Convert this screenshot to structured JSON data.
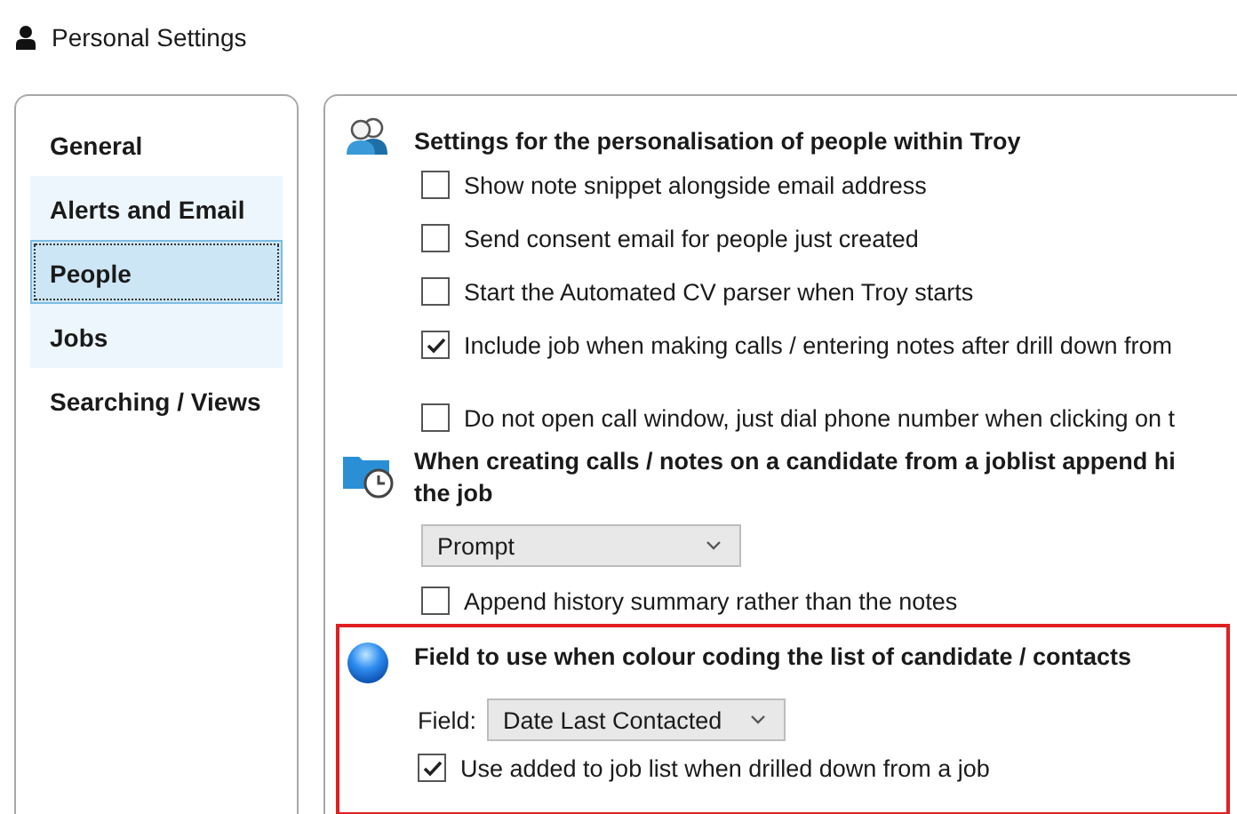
{
  "window": {
    "title": "Personal Settings"
  },
  "sidebar": {
    "items": [
      {
        "label": "General",
        "selected": false,
        "highlighted": false
      },
      {
        "label": "Alerts and Email",
        "selected": false,
        "highlighted": true
      },
      {
        "label": "People",
        "selected": true,
        "highlighted": false
      },
      {
        "label": "Jobs",
        "selected": false,
        "highlighted": true
      },
      {
        "label": "Searching / Views",
        "selected": false,
        "highlighted": false
      }
    ]
  },
  "sections": [
    {
      "title": "Settings for the personalisation of people within Troy",
      "outlined": false,
      "controls": [
        {
          "kind": "checkbox",
          "label": "Show note snippet alongside email address",
          "checked": false
        },
        {
          "kind": "checkbox",
          "label": "Send consent email for people just created",
          "checked": false
        },
        {
          "kind": "checkbox",
          "label": "Start the Automated CV parser when Troy starts",
          "checked": false
        },
        {
          "kind": "checkbox",
          "label": "Include job when making calls / entering notes after drill down from",
          "checked": true
        },
        {
          "kind": "checkbox",
          "label": "Do not open call window, just dial phone number when clicking on t",
          "checked": false
        }
      ]
    },
    {
      "title": "When creating calls / notes on a candidate from a joblist append hi",
      "title_line_2": "the job",
      "outlined": false,
      "controls": [
        {
          "kind": "dropdown",
          "value": "Prompt"
        },
        {
          "kind": "checkbox",
          "label": "Append history summary rather than the notes",
          "checked": false
        }
      ]
    },
    {
      "title": "Field to use when colour coding the list of candidate / contacts",
      "outlined": true,
      "controls": [
        {
          "kind": "dropdown",
          "label": "Field:",
          "value": "Date Last Contacted"
        },
        {
          "kind": "checkbox",
          "label": "Use added to job list when drilled down from a job",
          "checked": true
        }
      ]
    }
  ]
}
